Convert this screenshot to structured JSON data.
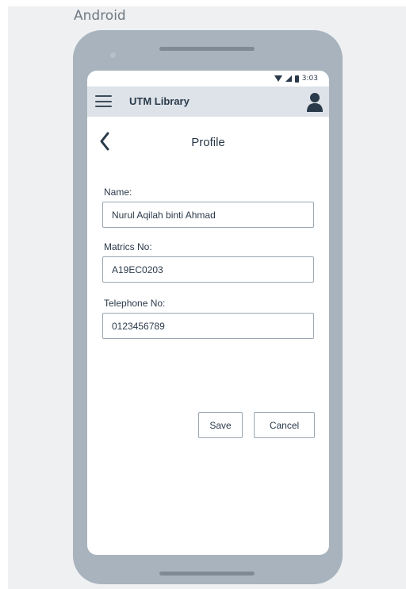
{
  "frame": {
    "label": "Android"
  },
  "status_bar": {
    "time": "3:03",
    "icons": [
      "wifi-icon",
      "signal-icon",
      "battery-icon"
    ]
  },
  "app_bar": {
    "menu_icon": "hamburger-menu-icon",
    "title": "UTM Library",
    "profile_icon": "user-icon"
  },
  "page": {
    "back_icon": "chevron-left-icon",
    "title": "Profile"
  },
  "form": {
    "name": {
      "label": "Name:",
      "value": "Nurul Aqilah binti Ahmad"
    },
    "matrics": {
      "label": "Matrics No:",
      "value": "A19EC0203"
    },
    "telephone": {
      "label": "Telephone No:",
      "value": "0123456789"
    }
  },
  "actions": {
    "save_label": "Save",
    "cancel_label": "Cancel"
  },
  "colors": {
    "app_bar_bg": "#dde3e9",
    "device_frame": "#a8b3bd",
    "text": "#2b3a4a",
    "input_border": "#9aa6b1"
  }
}
